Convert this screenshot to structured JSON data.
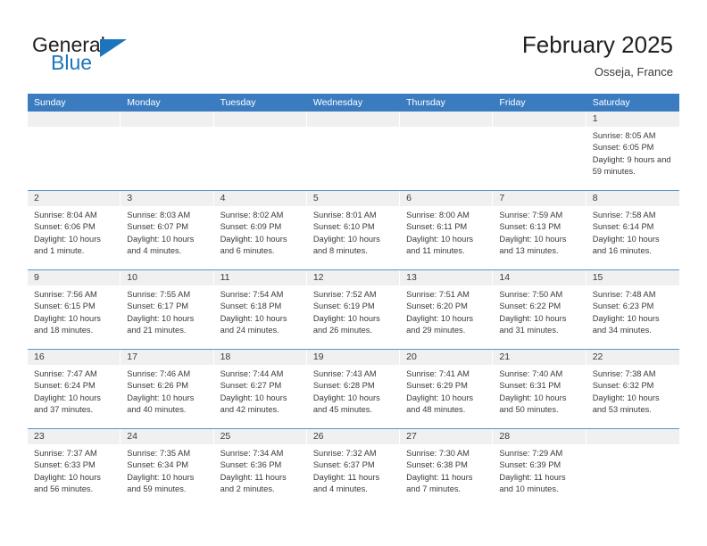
{
  "brand": {
    "name_part1": "General",
    "name_part2": "Blue",
    "flag_icon": "triangle-flag-icon"
  },
  "header": {
    "title": "February 2025",
    "location": "Osseja, France"
  },
  "calendar": {
    "weekdays": [
      "Sunday",
      "Monday",
      "Tuesday",
      "Wednesday",
      "Thursday",
      "Friday",
      "Saturday"
    ],
    "accent_color": "#3b7cc0",
    "row_divider_color": "#5a93cc",
    "day_strip_color": "#f0f0f0",
    "weeks": [
      [
        {
          "day": "",
          "empty": true
        },
        {
          "day": "",
          "empty": true
        },
        {
          "day": "",
          "empty": true
        },
        {
          "day": "",
          "empty": true
        },
        {
          "day": "",
          "empty": true
        },
        {
          "day": "",
          "empty": true
        },
        {
          "day": "1",
          "sunrise": "Sunrise: 8:05 AM",
          "sunset": "Sunset: 6:05 PM",
          "daylight": "Daylight: 9 hours and 59 minutes."
        }
      ],
      [
        {
          "day": "2",
          "sunrise": "Sunrise: 8:04 AM",
          "sunset": "Sunset: 6:06 PM",
          "daylight": "Daylight: 10 hours and 1 minute."
        },
        {
          "day": "3",
          "sunrise": "Sunrise: 8:03 AM",
          "sunset": "Sunset: 6:07 PM",
          "daylight": "Daylight: 10 hours and 4 minutes."
        },
        {
          "day": "4",
          "sunrise": "Sunrise: 8:02 AM",
          "sunset": "Sunset: 6:09 PM",
          "daylight": "Daylight: 10 hours and 6 minutes."
        },
        {
          "day": "5",
          "sunrise": "Sunrise: 8:01 AM",
          "sunset": "Sunset: 6:10 PM",
          "daylight": "Daylight: 10 hours and 8 minutes."
        },
        {
          "day": "6",
          "sunrise": "Sunrise: 8:00 AM",
          "sunset": "Sunset: 6:11 PM",
          "daylight": "Daylight: 10 hours and 11 minutes."
        },
        {
          "day": "7",
          "sunrise": "Sunrise: 7:59 AM",
          "sunset": "Sunset: 6:13 PM",
          "daylight": "Daylight: 10 hours and 13 minutes."
        },
        {
          "day": "8",
          "sunrise": "Sunrise: 7:58 AM",
          "sunset": "Sunset: 6:14 PM",
          "daylight": "Daylight: 10 hours and 16 minutes."
        }
      ],
      [
        {
          "day": "9",
          "sunrise": "Sunrise: 7:56 AM",
          "sunset": "Sunset: 6:15 PM",
          "daylight": "Daylight: 10 hours and 18 minutes."
        },
        {
          "day": "10",
          "sunrise": "Sunrise: 7:55 AM",
          "sunset": "Sunset: 6:17 PM",
          "daylight": "Daylight: 10 hours and 21 minutes."
        },
        {
          "day": "11",
          "sunrise": "Sunrise: 7:54 AM",
          "sunset": "Sunset: 6:18 PM",
          "daylight": "Daylight: 10 hours and 24 minutes."
        },
        {
          "day": "12",
          "sunrise": "Sunrise: 7:52 AM",
          "sunset": "Sunset: 6:19 PM",
          "daylight": "Daylight: 10 hours and 26 minutes."
        },
        {
          "day": "13",
          "sunrise": "Sunrise: 7:51 AM",
          "sunset": "Sunset: 6:20 PM",
          "daylight": "Daylight: 10 hours and 29 minutes."
        },
        {
          "day": "14",
          "sunrise": "Sunrise: 7:50 AM",
          "sunset": "Sunset: 6:22 PM",
          "daylight": "Daylight: 10 hours and 31 minutes."
        },
        {
          "day": "15",
          "sunrise": "Sunrise: 7:48 AM",
          "sunset": "Sunset: 6:23 PM",
          "daylight": "Daylight: 10 hours and 34 minutes."
        }
      ],
      [
        {
          "day": "16",
          "sunrise": "Sunrise: 7:47 AM",
          "sunset": "Sunset: 6:24 PM",
          "daylight": "Daylight: 10 hours and 37 minutes."
        },
        {
          "day": "17",
          "sunrise": "Sunrise: 7:46 AM",
          "sunset": "Sunset: 6:26 PM",
          "daylight": "Daylight: 10 hours and 40 minutes."
        },
        {
          "day": "18",
          "sunrise": "Sunrise: 7:44 AM",
          "sunset": "Sunset: 6:27 PM",
          "daylight": "Daylight: 10 hours and 42 minutes."
        },
        {
          "day": "19",
          "sunrise": "Sunrise: 7:43 AM",
          "sunset": "Sunset: 6:28 PM",
          "daylight": "Daylight: 10 hours and 45 minutes."
        },
        {
          "day": "20",
          "sunrise": "Sunrise: 7:41 AM",
          "sunset": "Sunset: 6:29 PM",
          "daylight": "Daylight: 10 hours and 48 minutes."
        },
        {
          "day": "21",
          "sunrise": "Sunrise: 7:40 AM",
          "sunset": "Sunset: 6:31 PM",
          "daylight": "Daylight: 10 hours and 50 minutes."
        },
        {
          "day": "22",
          "sunrise": "Sunrise: 7:38 AM",
          "sunset": "Sunset: 6:32 PM",
          "daylight": "Daylight: 10 hours and 53 minutes."
        }
      ],
      [
        {
          "day": "23",
          "sunrise": "Sunrise: 7:37 AM",
          "sunset": "Sunset: 6:33 PM",
          "daylight": "Daylight: 10 hours and 56 minutes."
        },
        {
          "day": "24",
          "sunrise": "Sunrise: 7:35 AM",
          "sunset": "Sunset: 6:34 PM",
          "daylight": "Daylight: 10 hours and 59 minutes."
        },
        {
          "day": "25",
          "sunrise": "Sunrise: 7:34 AM",
          "sunset": "Sunset: 6:36 PM",
          "daylight": "Daylight: 11 hours and 2 minutes."
        },
        {
          "day": "26",
          "sunrise": "Sunrise: 7:32 AM",
          "sunset": "Sunset: 6:37 PM",
          "daylight": "Daylight: 11 hours and 4 minutes."
        },
        {
          "day": "27",
          "sunrise": "Sunrise: 7:30 AM",
          "sunset": "Sunset: 6:38 PM",
          "daylight": "Daylight: 11 hours and 7 minutes."
        },
        {
          "day": "28",
          "sunrise": "Sunrise: 7:29 AM",
          "sunset": "Sunset: 6:39 PM",
          "daylight": "Daylight: 11 hours and 10 minutes."
        },
        {
          "day": "",
          "empty": true
        }
      ]
    ]
  }
}
